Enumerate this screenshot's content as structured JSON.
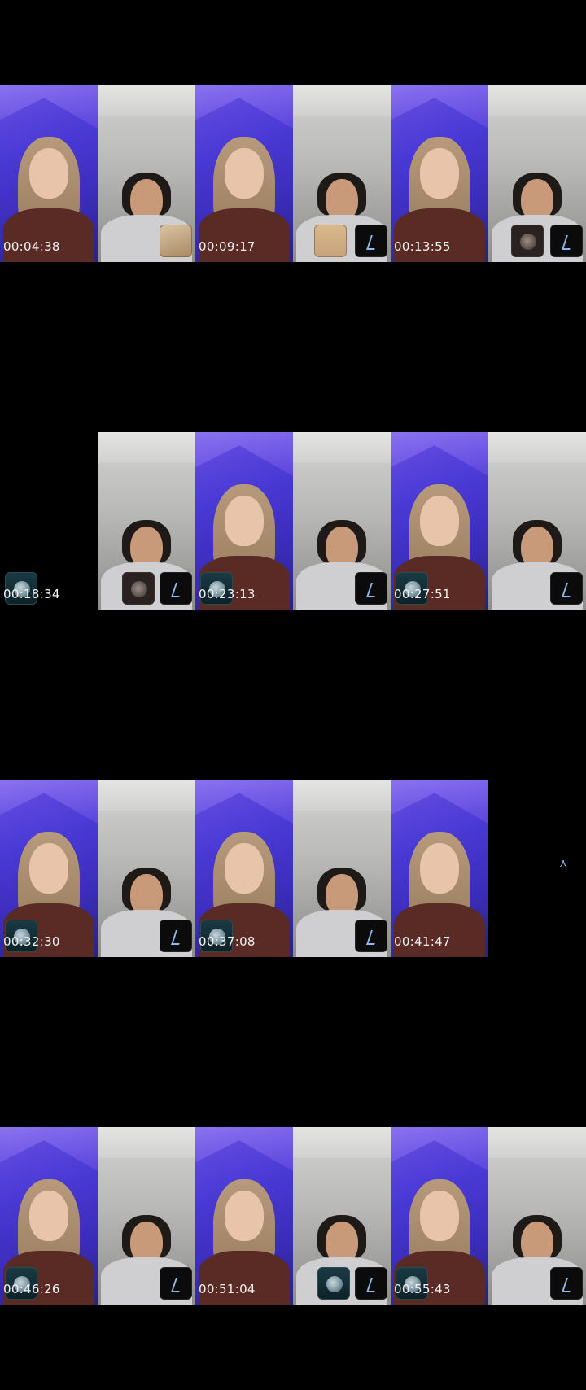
{
  "contact_sheet": {
    "rows": [
      {
        "timestamps": [
          "00:04:38",
          "00:09:17",
          "00:13:55"
        ],
        "tiles": [
          {
            "person": "girl",
            "overlays": []
          },
          {
            "person": "boy",
            "overlays": [
              "box-thumbnail"
            ]
          },
          {
            "person": "girl",
            "overlays": []
          },
          {
            "person": "boy",
            "overlays": [
              "caller-thumbnail",
              "app-logo-icon"
            ]
          },
          {
            "person": "girl",
            "overlays": []
          },
          {
            "person": "boy",
            "overlays": [
              "moon-thumbnail",
              "app-logo-icon"
            ]
          }
        ]
      },
      {
        "timestamps": [
          "00:18:34",
          "00:23:13",
          "00:27:51"
        ],
        "tiles": [
          {
            "person": "blank",
            "overlays": [
              "globe-thumbnail"
            ]
          },
          {
            "person": "boy",
            "overlays": [
              "moon-thumbnail",
              "app-logo-icon"
            ]
          },
          {
            "person": "girl",
            "overlays": [
              "globe-thumbnail"
            ]
          },
          {
            "person": "boy",
            "overlays": [
              "app-logo-icon"
            ]
          },
          {
            "person": "girl",
            "overlays": [
              "globe-thumbnail"
            ]
          },
          {
            "person": "boy",
            "overlays": [
              "app-logo-icon"
            ]
          }
        ]
      },
      {
        "timestamps": [
          "00:32:30",
          "00:37:08",
          "00:41:47"
        ],
        "tiles": [
          {
            "person": "girl",
            "overlays": [
              "globe-thumbnail"
            ]
          },
          {
            "person": "boy",
            "overlays": [
              "app-logo-icon"
            ]
          },
          {
            "person": "girl",
            "overlays": [
              "globe-thumbnail"
            ]
          },
          {
            "person": "boy",
            "overlays": [
              "app-logo-icon"
            ]
          },
          {
            "person": "girl",
            "overlays": []
          },
          {
            "person": "blank",
            "overlays": [
              "small-app-logo-icon"
            ]
          }
        ]
      },
      {
        "timestamps": [
          "00:46:26",
          "00:51:04",
          "00:55:43"
        ],
        "tiles": [
          {
            "person": "girl",
            "overlays": [
              "globe-thumbnail"
            ]
          },
          {
            "person": "boy",
            "overlays": [
              "app-logo-icon"
            ]
          },
          {
            "person": "girl",
            "overlays": []
          },
          {
            "person": "boy",
            "overlays": [
              "globe-thumbnail",
              "app-logo-icon"
            ]
          },
          {
            "person": "girl",
            "overlays": [
              "globe-thumbnail"
            ]
          },
          {
            "person": "boy",
            "overlays": [
              "app-logo-icon"
            ]
          }
        ]
      }
    ]
  },
  "colors": {
    "background": "#000000",
    "girl_backdrop": "#4a3ad6",
    "boy_backdrop": "#b9b9b7",
    "timestamp_text": "#f2f2f2",
    "logo_accent": "#8fb8e8"
  }
}
